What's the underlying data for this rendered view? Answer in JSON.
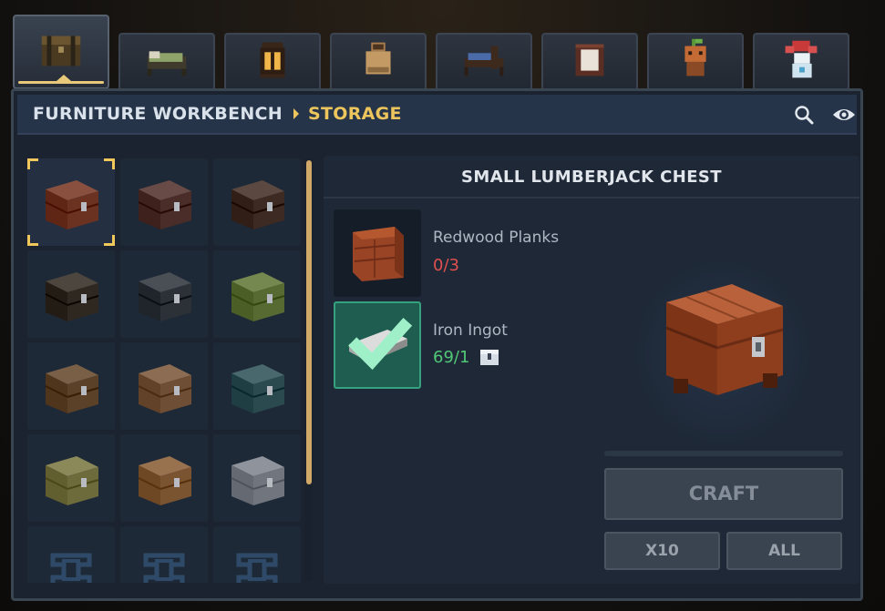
{
  "tabs": [
    {
      "icon": "chest-icon",
      "active": true
    },
    {
      "icon": "bed-icon",
      "active": false
    },
    {
      "icon": "lantern-icon",
      "active": false
    },
    {
      "icon": "vase-icon",
      "active": false
    },
    {
      "icon": "blue-bed-icon",
      "active": false
    },
    {
      "icon": "lamp-icon",
      "active": false
    },
    {
      "icon": "sprout-figure-icon",
      "active": false
    },
    {
      "icon": "snowman-icon",
      "active": false
    }
  ],
  "header": {
    "breadcrumb_1": "FURNITURE WORKBENCH",
    "breadcrumb_2": "STORAGE",
    "search_icon": "search-icon",
    "visibility_icon": "eye-icon"
  },
  "grid": {
    "items": [
      {
        "name": "small-lumberjack-chest",
        "color": "#6b3222",
        "selected": true
      },
      {
        "name": "chest-dark",
        "color": "#4a2d28"
      },
      {
        "name": "chest-iron-banded",
        "color": "#3d2a22"
      },
      {
        "name": "chest-dim",
        "color": "#2f2820"
      },
      {
        "name": "chest-steel",
        "color": "#2c3138"
      },
      {
        "name": "chest-mossy",
        "color": "#566a32"
      },
      {
        "name": "chest-wooden",
        "color": "#5a4128"
      },
      {
        "name": "chest-bound",
        "color": "#6e4f35"
      },
      {
        "name": "chest-teal",
        "color": "#2a4a50"
      },
      {
        "name": "chest-olive",
        "color": "#6d6a3c"
      },
      {
        "name": "chest-oak",
        "color": "#7a5331"
      },
      {
        "name": "chest-stone",
        "color": "#70757e"
      },
      {
        "name": "locked-1",
        "color": "#2e4a68"
      },
      {
        "name": "locked-2",
        "color": "#2e4a68"
      },
      {
        "name": "locked-3",
        "color": "#2e4a68"
      }
    ]
  },
  "detail": {
    "title": "SMALL LUMBERJACK CHEST",
    "ingredients": [
      {
        "name": "Redwood Planks",
        "count": "0/3",
        "satisfied": false
      },
      {
        "name": "Iron Ingot",
        "count": "69/1",
        "satisfied": true
      }
    ],
    "craft_label": "CRAFT",
    "x10_label": "X10",
    "all_label": "ALL"
  },
  "colors": {
    "accent": "#ecc55c",
    "insufficient": "#e05050",
    "sufficient": "#51c878"
  }
}
